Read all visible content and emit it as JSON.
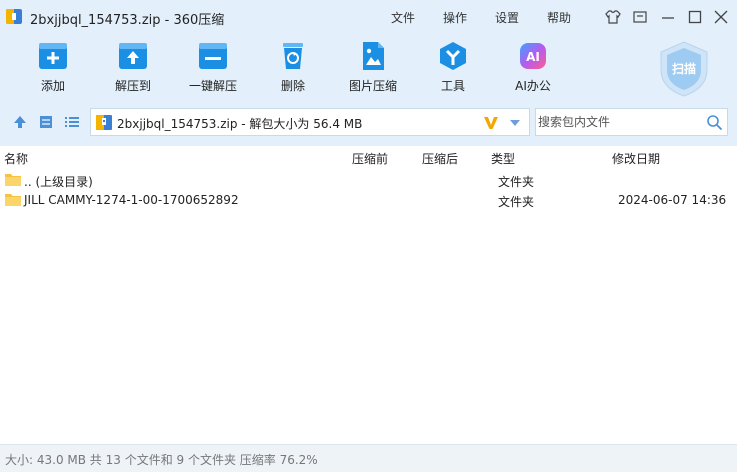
{
  "window": {
    "title": "2bxjjbql_154753.zip - 360压缩"
  },
  "menu": {
    "file": "文件",
    "operation": "操作",
    "settings": "设置",
    "help": "帮助"
  },
  "toolbar": {
    "add": "添加",
    "extract_to": "解压到",
    "one_click_extract": "一键解压",
    "delete": "删除",
    "image_compress": "图片压缩",
    "tools": "工具",
    "ai_office": "AI办公",
    "ai_badge": "AI",
    "scan": "扫描"
  },
  "address": {
    "path": "2bxjjbql_154753.zip - 解包大小为 56.4 MB"
  },
  "search": {
    "placeholder": "搜索包内文件"
  },
  "columns": {
    "name": "名称",
    "compressed_before": "压缩前",
    "compressed_after": "压缩后",
    "type": "类型",
    "modified": "修改日期"
  },
  "files": [
    {
      "name": ".. (上级目录)",
      "type": "文件夹",
      "modified": ""
    },
    {
      "name": "JILL CAMMY-1274-1-00-1700652892",
      "type": "文件夹",
      "modified": "2024-06-07 14:36"
    }
  ],
  "status": {
    "text": "大小: 43.0 MB 共 13 个文件和 9 个文件夹 压缩率 76.2%"
  },
  "colors": {
    "accent": "#1a8fe3",
    "toolbar_bg": "#e3f0fb",
    "folder": "#f5c242",
    "extract_v": "#f2a800"
  }
}
